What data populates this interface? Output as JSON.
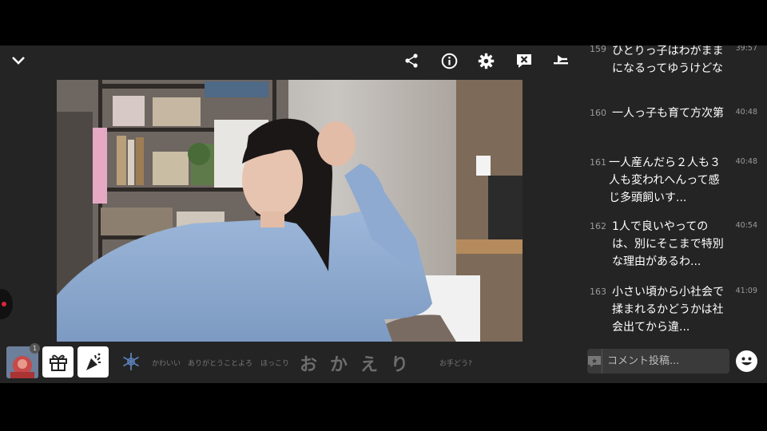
{
  "topbar": {
    "icons": [
      "chevron-down-icon",
      "share-icon",
      "info-icon",
      "gear-icon",
      "close-comments-icon",
      "quality-icon"
    ]
  },
  "comments": [
    {
      "num": "159",
      "time": "39:57",
      "text": "ひとりっ子はわがままになるってゆうけどな"
    },
    {
      "num": "160",
      "time": "40:48",
      "text": "一人っ子も育て方次第"
    },
    {
      "num": "161",
      "time": "40:48",
      "text": "一人産んだら２人も３人も変われへんって感じ多頭飼いす..."
    },
    {
      "num": "162",
      "time": "40:54",
      "text": "1人で良いやってのは、別にそこまで特別な理由があるわ..."
    },
    {
      "num": "163",
      "time": "41:09",
      "text": "小さい頃から小社会で揉まれるかどうかは社会出てから違..."
    }
  ],
  "bottombar": {
    "avatar_badge": "1",
    "phrases": [
      "かわいい",
      "ありがとう",
      "ことよろ",
      "ほっこり",
      "お手どう?"
    ],
    "big_phrase": "おかえり"
  },
  "comment_input": {
    "placeholder": "コメント投稿..."
  },
  "colors": {
    "background": "#242424",
    "panel": "#3a3a3a",
    "accent_red": "#e0223a"
  }
}
